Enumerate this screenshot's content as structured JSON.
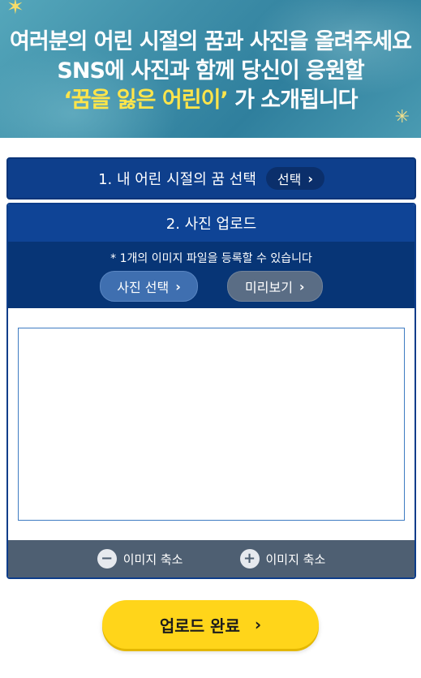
{
  "banner": {
    "line1": "여러분의 어린 시절의 꿈과 사진을 올려주세요",
    "line2": "SNS에 사진과 함께 당신이 응원할",
    "line3_highlight": "‘꿈을 잃은 어린이’",
    "line3_rest": " 가 소개됩니다"
  },
  "section1": {
    "title": "1. 내 어린 시절의 꿈 선택",
    "button_label": "선택"
  },
  "section2": {
    "title": "2. 사진 업로드",
    "note": "* 1개의 이미지 파일을 등록할 수 있습니다",
    "photo_button": "사진 선택",
    "preview_button": "미리보기",
    "zoom_out_label": "이미지 축소",
    "zoom_in_label": "이미지 축소"
  },
  "complete_button": "업로드 완료",
  "icons": {
    "chevron": "chevron-right-icon",
    "minus": "minus-circle-icon",
    "plus": "plus-circle-icon",
    "sparkle": "sparkle-icon"
  },
  "colors": {
    "primary_blue": "#0f4496",
    "dark_blue": "#073576",
    "accent_yellow": "#ffd51a",
    "highlight_text": "#ffe54a"
  }
}
